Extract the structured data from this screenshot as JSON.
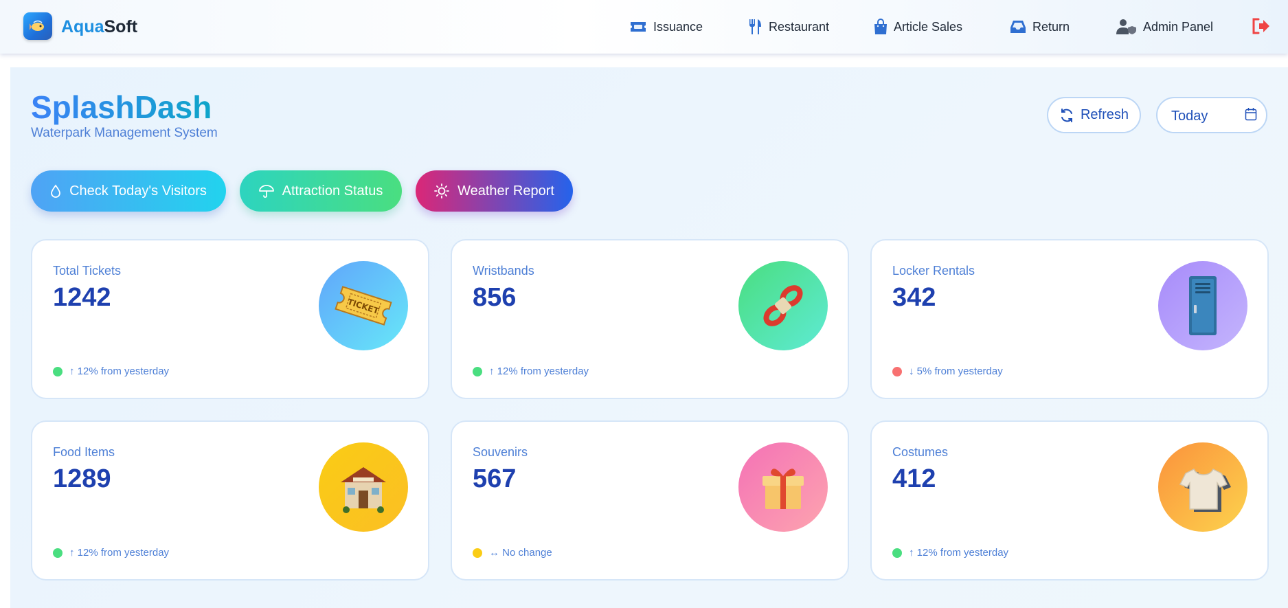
{
  "app": {
    "brand_prefix": "Aqua",
    "brand_suffix": "Soft"
  },
  "nav": [
    {
      "label": "Issuance",
      "icon": "ticket-icon"
    },
    {
      "label": "Restaurant",
      "icon": "utensils-icon"
    },
    {
      "label": "Article Sales",
      "icon": "shopping-bag-icon"
    },
    {
      "label": "Return",
      "icon": "inbox-icon"
    },
    {
      "label": "Admin Panel",
      "icon": "user-shield-icon"
    }
  ],
  "header": {
    "title": "SplashDash",
    "subtitle": "Waterpark Management System",
    "refresh_label": "Refresh",
    "date_value": "Today"
  },
  "actions": [
    {
      "label": "Check Today's Visitors",
      "icon": "droplet-icon"
    },
    {
      "label": "Attraction Status",
      "icon": "umbrella-icon"
    },
    {
      "label": "Weather Report",
      "icon": "sun-icon"
    }
  ],
  "stats": [
    {
      "label": "Total Tickets",
      "value": "1242",
      "trend": "↑ 12% from yesterday",
      "trend_color": "#4ade80",
      "icon": "ticket-icon",
      "circle": [
        "#60a5fa",
        "#67e8f9"
      ]
    },
    {
      "label": "Wristbands",
      "value": "856",
      "trend": "↑ 12% from yesterday",
      "trend_color": "#4ade80",
      "icon": "wristband-icon",
      "circle": [
        "#4ade80",
        "#5eead4"
      ]
    },
    {
      "label": "Locker Rentals",
      "value": "342",
      "trend": "↓ 5% from yesterday",
      "trend_color": "#f87171",
      "icon": "locker-icon",
      "circle": [
        "#a78bfa",
        "#c4b5fd"
      ]
    },
    {
      "label": "Food Items",
      "value": "1289",
      "trend": "↑ 12% from yesterday",
      "trend_color": "#4ade80",
      "icon": "restaurant-icon",
      "circle": [
        "#facc15",
        "#fbbf24"
      ]
    },
    {
      "label": "Souvenirs",
      "value": "567",
      "trend": "↔ No change",
      "trend_color": "#facc15",
      "icon": "gift-icon",
      "circle": [
        "#f472b6",
        "#fda4af"
      ]
    },
    {
      "label": "Costumes",
      "value": "412",
      "trend": "↑ 12% from yesterday",
      "trend_color": "#4ade80",
      "icon": "tshirt-icon",
      "circle": [
        "#fb923c",
        "#fcd34d"
      ]
    }
  ]
}
